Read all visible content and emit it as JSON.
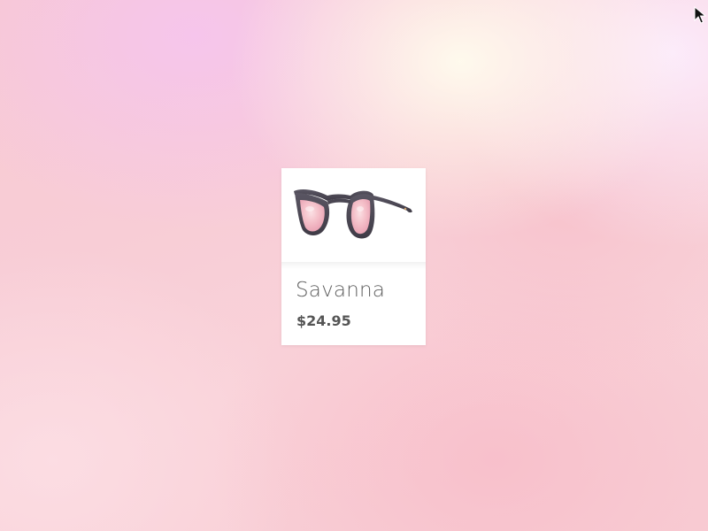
{
  "product": {
    "name": "Savanna",
    "price": "$24.95",
    "image_icon": "sunglasses-icon",
    "lens_color": "#f3b6c3",
    "frame_color": "#4e4a55"
  },
  "cursor": {
    "icon": "mouse-pointer-icon"
  }
}
